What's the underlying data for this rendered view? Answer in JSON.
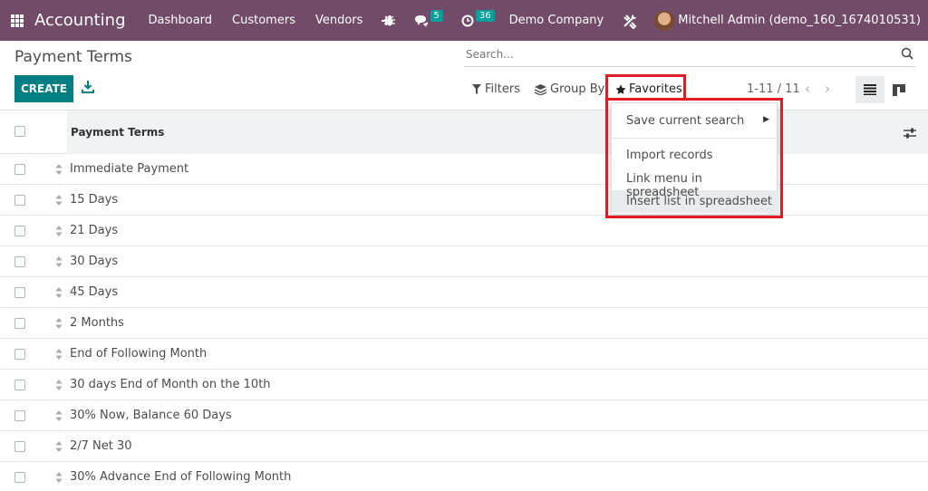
{
  "navbar": {
    "app_title": "Accounting",
    "menu": [
      "Dashboard",
      "Customers",
      "Vendors"
    ],
    "plus_label": "+",
    "messages_count": "5",
    "activities_count": "36",
    "company": "Demo Company",
    "user": "Mitchell Admin (demo_160_1674010531)",
    "bg_color": "#714b67"
  },
  "control_panel": {
    "title": "Payment Terms",
    "search_placeholder": "Search...",
    "create_label": "CREATE",
    "filters_label": "Filters",
    "groupby_label": "Group By",
    "favorites_label": "Favorites",
    "pager": "1-11 / 11",
    "accent_color": "#017e84"
  },
  "favorites_menu": {
    "items": [
      "Save current search",
      "Import records",
      "Link menu in spreadsheet",
      "Insert list in spreadsheet"
    ],
    "highlight_color": "#e31b23"
  },
  "table": {
    "column_header": "Payment Terms",
    "rows": [
      "Immediate Payment",
      "15 Days",
      "21 Days",
      "30 Days",
      "45 Days",
      "2 Months",
      "End of Following Month",
      "30 days End of Month on the 10th",
      "30% Now, Balance 60 Days",
      "2/7 Net 30",
      "30% Advance End of Following Month"
    ]
  }
}
